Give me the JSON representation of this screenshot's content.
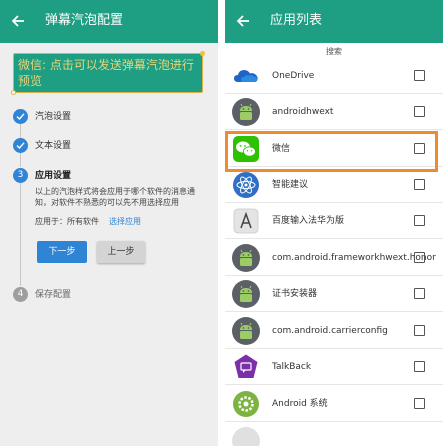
{
  "left_screen": {
    "title": "弹幕汽泡配置",
    "bubble_text": "微信: 点击可以发送弹幕汽泡进行预览",
    "steps": [
      {
        "num": "1",
        "label": "汽泡设置",
        "state": "done"
      },
      {
        "num": "2",
        "label": "文本设置",
        "state": "done"
      },
      {
        "num": "3",
        "label": "应用设置",
        "state": "active"
      },
      {
        "num": "4",
        "label": "保存配置",
        "state": "pending"
      }
    ],
    "description": "以上的汽泡样式将会应用于哪个软件的消息通知，对软件不熟悉的可以先不用选择应用",
    "apply_prefix": "应用于：所有软件",
    "select_app_link": "选择应用",
    "next_button": "下一步",
    "prev_button": "上一步"
  },
  "right_screen": {
    "title": "应用列表",
    "search_label": "搜索",
    "apps": [
      {
        "label": "OneDrive",
        "icon": "onedrive-icon",
        "checked": false
      },
      {
        "label": "androidhwext",
        "icon": "android-icon",
        "checked": false
      },
      {
        "label": "微信",
        "icon": "wechat-icon",
        "checked": false
      },
      {
        "label": "智能建议",
        "icon": "atom-icon",
        "checked": false
      },
      {
        "label": "百度输入法华为版",
        "icon": "letter-a-icon",
        "checked": false
      },
      {
        "label": "com.android.frameworkhwext.honor",
        "icon": "android-icon",
        "checked": false
      },
      {
        "label": "证书安装器",
        "icon": "android-icon",
        "checked": false
      },
      {
        "label": "com.android.carrierconfig",
        "icon": "android-icon",
        "checked": false
      },
      {
        "label": "TalkBack",
        "icon": "talkback-icon",
        "checked": false
      },
      {
        "label": "Android 系统",
        "icon": "gear-icon",
        "checked": false
      }
    ]
  },
  "colors": {
    "primary": "#1e9e82",
    "accent": "#2f84d6",
    "highlight": "#ef8b2c"
  }
}
